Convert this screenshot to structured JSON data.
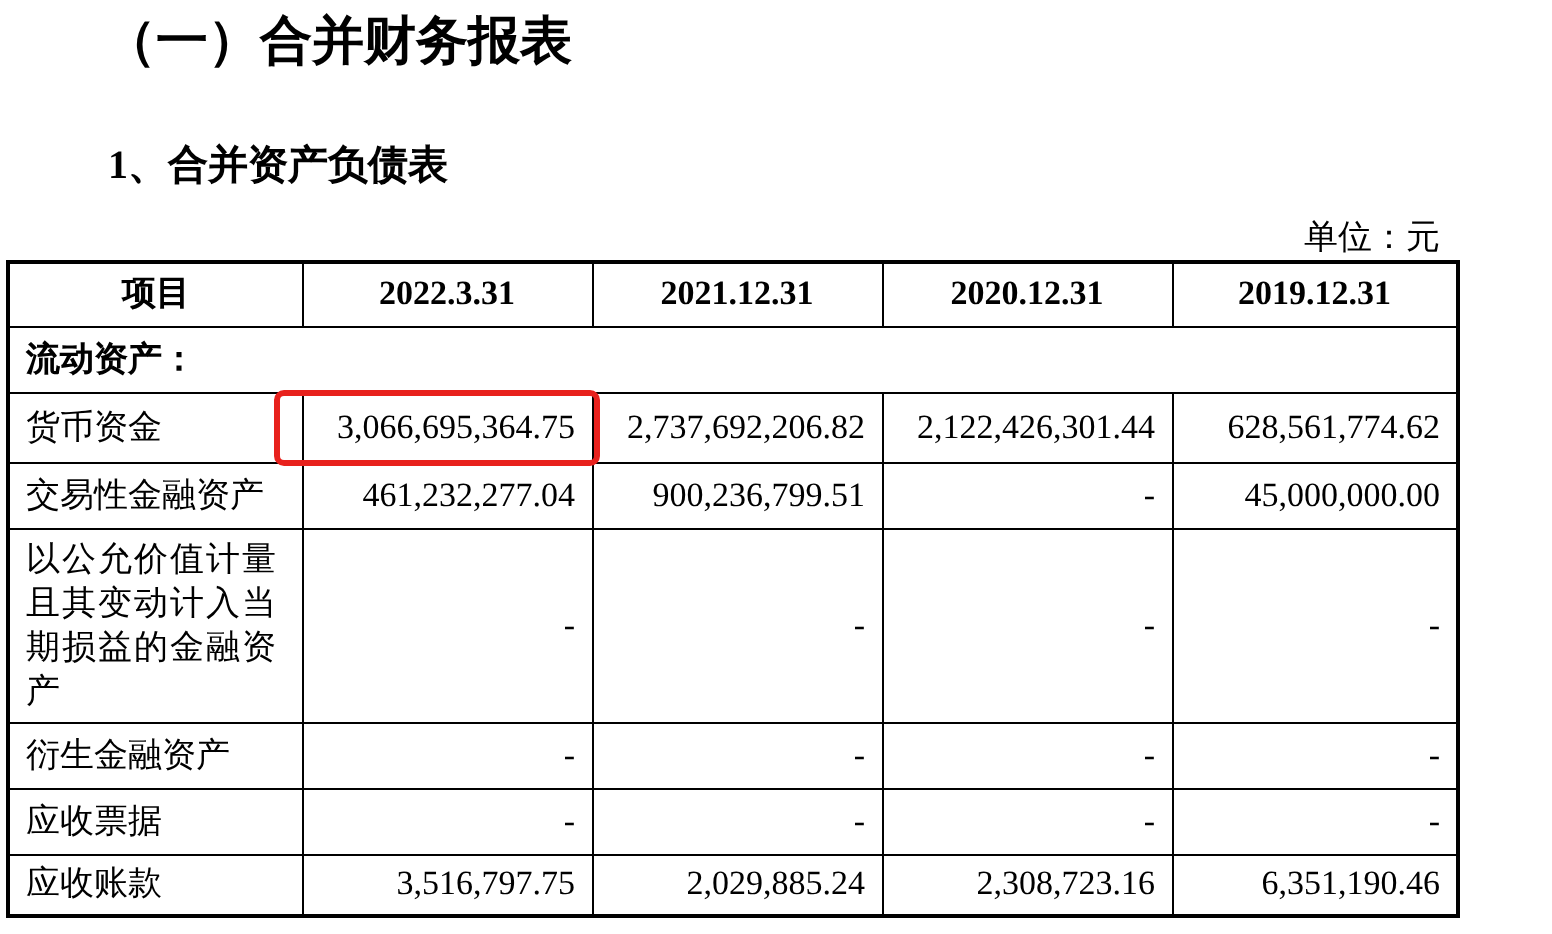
{
  "section_title": "（一）合并财务报表",
  "table_title": "1、合并资产负债表",
  "unit": "单位：元",
  "table": {
    "columns": [
      "项目",
      "2022.3.31",
      "2021.12.31",
      "2020.12.31",
      "2019.12.31"
    ],
    "rows": [
      {
        "kind": "group",
        "label": "流动资产："
      },
      {
        "kind": "data",
        "label": "货币资金",
        "cells": [
          {
            "text": "3,066,695,364.75",
            "highlighted": true
          },
          {
            "text": "2,737,692,206.82",
            "highlighted": false
          },
          {
            "text": "2,122,426,301.44",
            "highlighted": false
          },
          {
            "text": "628,561,774.62",
            "highlighted": false
          }
        ]
      },
      {
        "kind": "data",
        "label": "交易性金融资产",
        "cells": [
          {
            "text": "461,232,277.04",
            "highlighted": false
          },
          {
            "text": "900,236,799.51",
            "highlighted": false
          },
          {
            "text": "-",
            "highlighted": false
          },
          {
            "text": "45,000,000.00",
            "highlighted": false
          }
        ]
      },
      {
        "kind": "data",
        "label": "以公允价值计量且其变动计入当期损益的金融资产",
        "cells": [
          {
            "text": "-",
            "highlighted": false
          },
          {
            "text": "-",
            "highlighted": false
          },
          {
            "text": "-",
            "highlighted": false
          },
          {
            "text": "-",
            "highlighted": false
          }
        ]
      },
      {
        "kind": "data",
        "label": "衍生金融资产",
        "cells": [
          {
            "text": "-",
            "highlighted": false
          },
          {
            "text": "-",
            "highlighted": false
          },
          {
            "text": "-",
            "highlighted": false
          },
          {
            "text": "-",
            "highlighted": false
          }
        ]
      },
      {
        "kind": "data",
        "label": "应收票据",
        "cells": [
          {
            "text": "-",
            "highlighted": false
          },
          {
            "text": "-",
            "highlighted": false
          },
          {
            "text": "-",
            "highlighted": false
          },
          {
            "text": "-",
            "highlighted": false
          }
        ]
      },
      {
        "kind": "data",
        "label": "应收账款",
        "cells": [
          {
            "text": "3,516,797.75",
            "highlighted": false
          },
          {
            "text": "2,029,885.24",
            "highlighted": false
          },
          {
            "text": "2,308,723.16",
            "highlighted": false
          },
          {
            "text": "6,351,190.46",
            "highlighted": false
          }
        ]
      }
    ]
  }
}
